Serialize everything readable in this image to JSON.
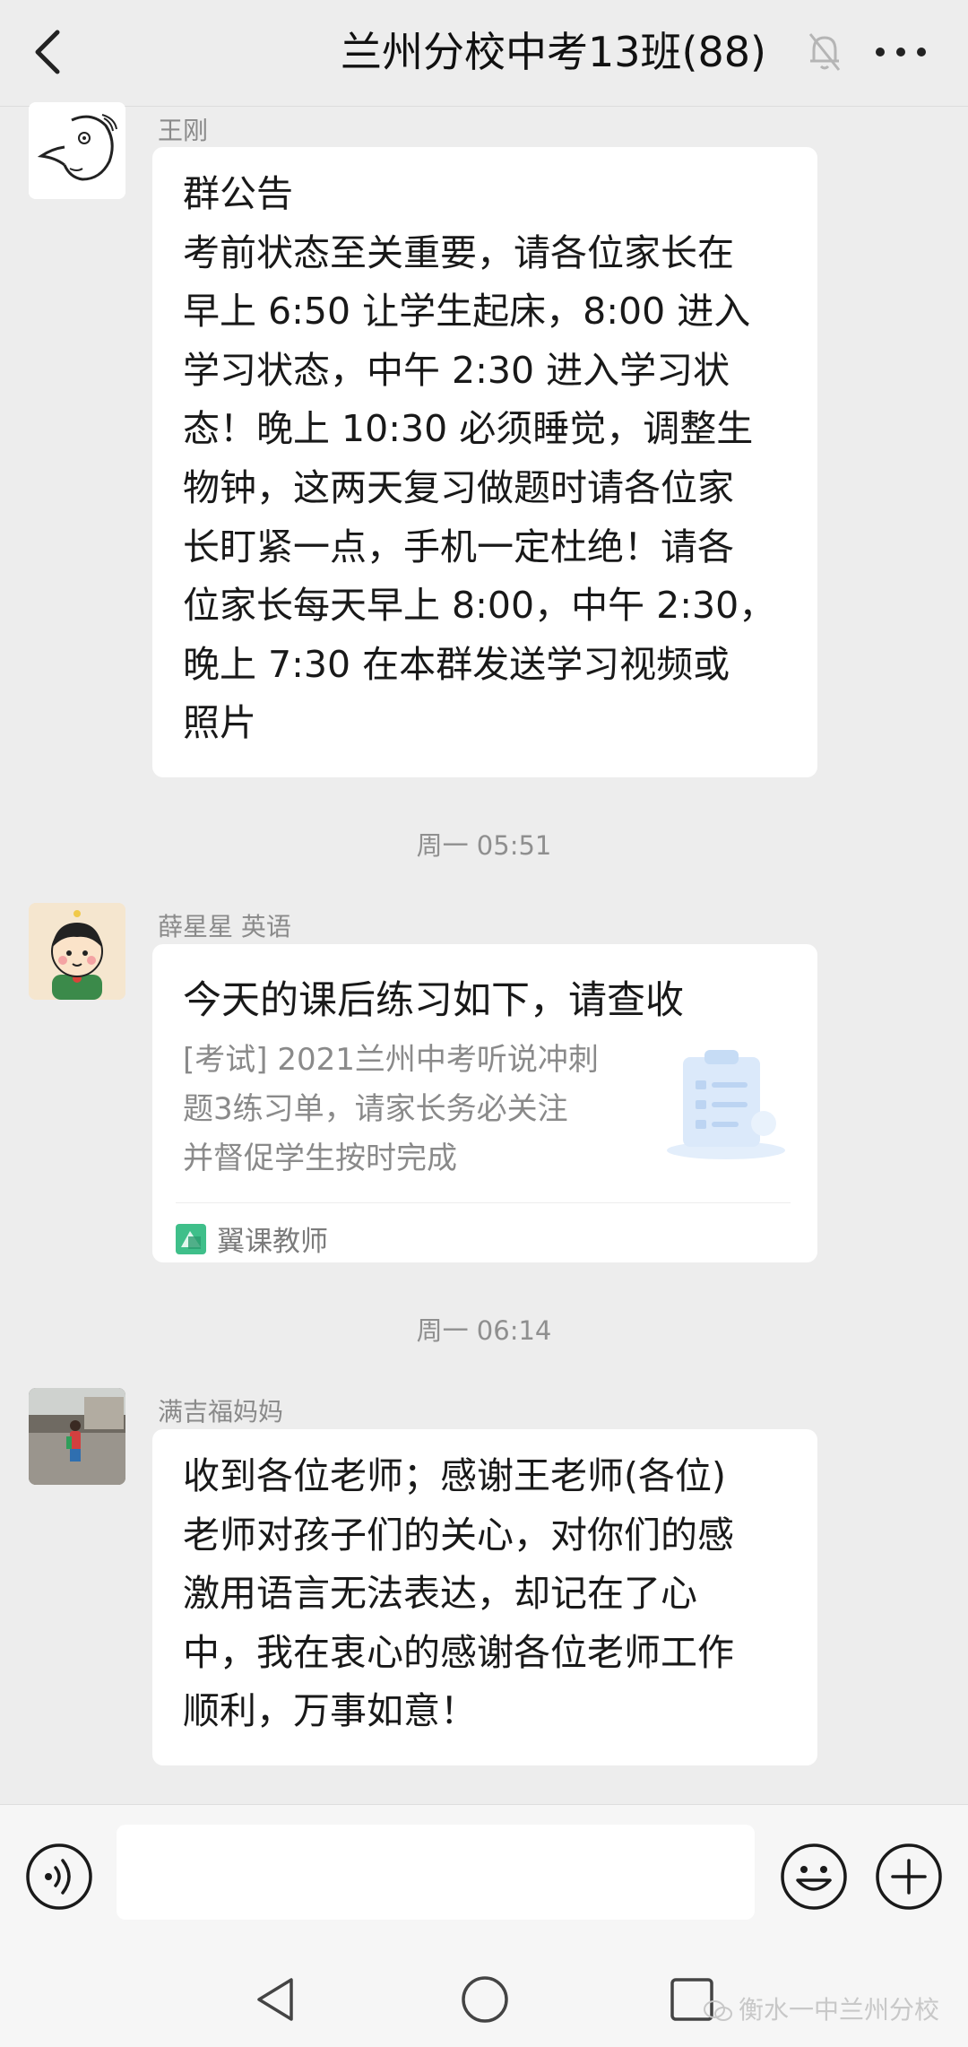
{
  "header": {
    "title": "兰州分校中考13班(88)",
    "back_icon": "chevron-left-icon",
    "mute_icon": "bell-off-icon",
    "more_icon": "more-horizontal-icon"
  },
  "messages": [
    {
      "sender": "王刚",
      "avatar": "cartoon-face-avatar",
      "text": "群公告\n考前状态至关重要，请各位家长在\n早上 6:50 让学生起床，8:00 进入\n学习状态，中午 2:30 进入学习状\n态！晚上 10:30 必须睡觉，调整生\n物钟，这两天复习做题时请各位家\n长盯紧一点，手机一定杜绝！请各\n位家长每天早上 8:00，中午 2:30，\n晚上 7:30 在本群发送学习视频或\n照片"
    },
    {
      "timestamp": "周一 05:51",
      "sender": "薛星星 英语",
      "avatar": "cartoon-boy-avatar",
      "card": {
        "title": "今天的课后练习如下，请查收",
        "desc": "[考试] 2021兰州中考听说冲刺\n题3练习单，请家长务必关注\n并督促学生按时完成",
        "thumb_icon": "clipboard-icon",
        "source_icon": "app-logo-icon",
        "source": "翼课教师"
      }
    },
    {
      "timestamp": "周一 06:14",
      "sender": "满吉福妈妈",
      "avatar": "photo-avatar",
      "text": "收到各位老师；感谢王老师(各位)\n老师对孩子们的关心，对你们的感\n激用语言无法表达，却记在了心\n中，我在衷心的感谢各位老师工作\n顺利，万事如意！"
    }
  ],
  "input_bar": {
    "voice_icon": "voice-icon",
    "input_value": "",
    "emoji_icon": "emoji-icon",
    "plus_icon": "plus-circle-icon"
  },
  "nav_bar": {
    "back_icon": "triangle-back-icon",
    "home_icon": "circle-home-icon",
    "recent_icon": "square-recent-icon"
  },
  "watermark": "衡水一中兰州分校",
  "colors": {
    "background": "#ededed",
    "bubble": "#ffffff",
    "meta_text": "#8a8a8a"
  }
}
